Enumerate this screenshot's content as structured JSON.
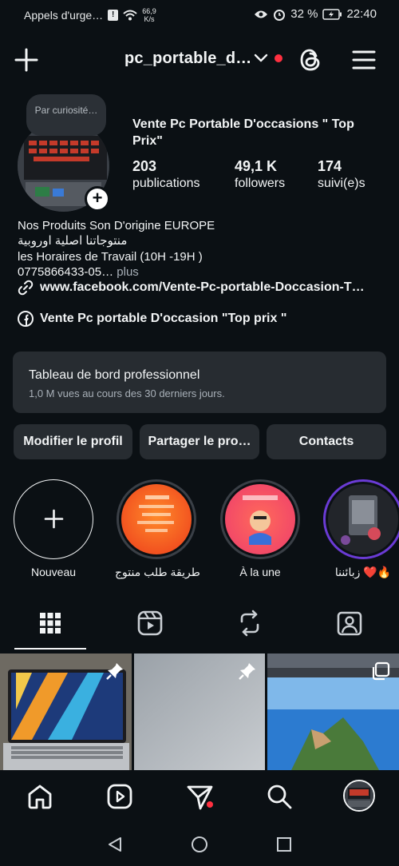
{
  "status": {
    "carrier": "Appels d'urge…",
    "speed_value": "66,9",
    "speed_unit": "K/s",
    "battery": "32 %",
    "time": "22:40"
  },
  "header": {
    "username": "pc_portable_d…"
  },
  "profile": {
    "note": "Par curiosité…",
    "full_name": "Vente Pc Portable D'occasions \" Top Prix\"",
    "posts_count": "203",
    "posts_label": "publications",
    "followers_count": "49,1 K",
    "followers_label": "followers",
    "following_count": "174",
    "following_label": "suivi(e)s",
    "bio_line1": "Nos Produits Son D'origine EUROPE",
    "bio_line2": "منتوجاتنا اصلية اوروبية",
    "bio_line3": "les Horaires de Travail (10H -19H )",
    "bio_line4": "0775866433-05…",
    "bio_more": "plus",
    "link": "www.facebook.com/Vente-Pc-portable-Doccasion-T…",
    "facebook_page": "Vente Pc portable D'occasion \"Top prix \""
  },
  "dashboard": {
    "title": "Tableau de bord professionnel",
    "subtitle": "1,0 M vues au cours des 30 derniers jours."
  },
  "buttons": {
    "edit": "Modifier le profil",
    "share": "Partager le pro…",
    "contacts": "Contacts"
  },
  "highlights": [
    {
      "label": "Nouveau"
    },
    {
      "label": "طريقة طلب منتوج"
    },
    {
      "label": "À la une"
    },
    {
      "label": "زبائننا ❤️🔥"
    }
  ],
  "colors": {
    "background": "#0b1014",
    "surface": "#272c31",
    "notification_dot": "#ff3040",
    "muted_text": "#a8b0b8"
  },
  "icons": {
    "header": [
      "plus-icon",
      "chevron-down-icon",
      "threads-icon",
      "menu-icon"
    ],
    "tabs": [
      "grid-icon",
      "reels-icon",
      "reposts-icon",
      "tagged-icon"
    ],
    "bottom_nav": [
      "home-icon",
      "reels-icon",
      "direct-icon",
      "search-icon",
      "profile-avatar"
    ]
  }
}
